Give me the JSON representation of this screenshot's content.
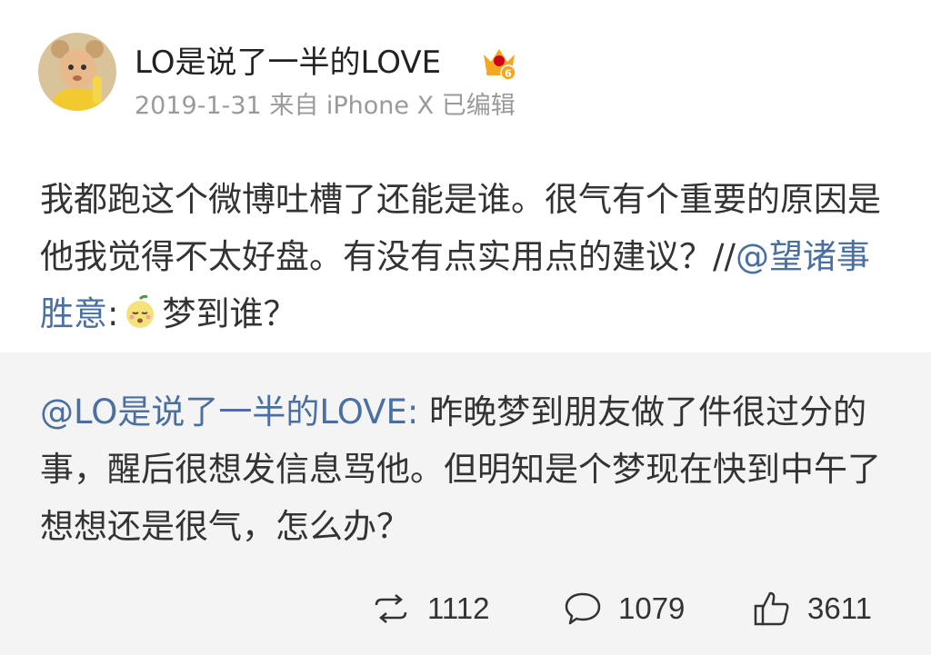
{
  "post": {
    "username": "LO是说了一半的LOVE",
    "meta": "2019-1-31  来自 iPhone X  已编辑",
    "body_text": "我都跑这个微博吐槽了还能是谁。很气有个重要的原因是他我觉得不太好盘。有没有点实用点的建议？//",
    "mention": "@望诸事胜意",
    "colon": ":",
    "emoji_name": "sleepy-fruit-emoji",
    "body_tail": "梦到谁？"
  },
  "quoted": {
    "mention": "@LO是说了一半的LOVE:",
    "text": " 昨晚梦到朋友做了件很过分的事，醒后很想发信息骂他。但明知是个梦现在快到中午了想想还是很气，怎么办？"
  },
  "actions": {
    "repost_count": "1112",
    "comment_count": "1079",
    "like_count": "3611"
  },
  "colors": {
    "mention": "#4a6fa1",
    "meta": "#9a9a9a",
    "quoted_bg": "#f4f4f4",
    "badge": "#f5a623"
  },
  "icons": [
    "avatar",
    "vip-crown-icon",
    "repost-icon",
    "comment-icon",
    "like-icon"
  ]
}
